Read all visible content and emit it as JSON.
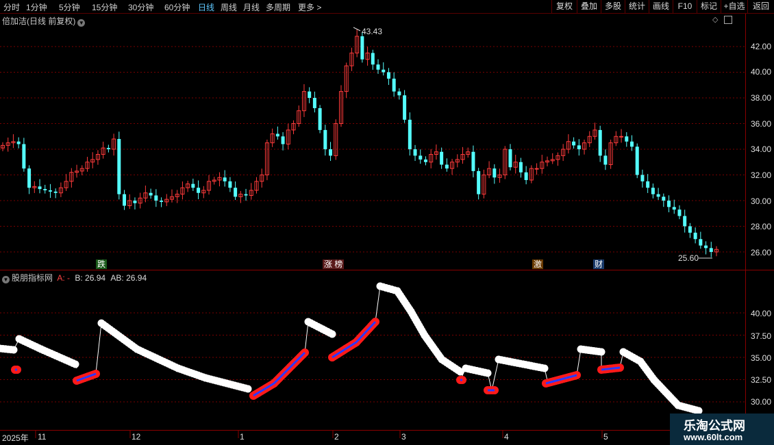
{
  "toolbar": {
    "periods": [
      "分时",
      "1分钟",
      "5分钟",
      "15分钟",
      "30分钟",
      "60分钟",
      "日线",
      "周线",
      "月线",
      "多周期",
      "更多 >"
    ],
    "active_period": "日线",
    "right_buttons": [
      "复权",
      "叠加",
      "多股",
      "统计",
      "画线",
      "F10",
      "标记",
      "+自选",
      "返回"
    ]
  },
  "main_pane": {
    "title": "倍加洁(日线 前复权)",
    "price_axis": [
      "42.00",
      "40.00",
      "38.00",
      "36.00",
      "34.00",
      "32.00",
      "30.00",
      "28.00",
      "26.00"
    ],
    "high_label": "43.43",
    "low_label": "25.60",
    "event_tags": [
      "跌",
      "涨 榜",
      "激",
      "财"
    ]
  },
  "indicator_pane": {
    "title": "股朋指标网",
    "a_label": "A: -",
    "b_label": "B: 26.94",
    "ab_label": "AB: 26.94",
    "axis": [
      "40.00",
      "37.50",
      "35.00",
      "32.50",
      "30.00"
    ]
  },
  "date_axis": {
    "year": "2025年",
    "months": [
      "11",
      "12",
      "1",
      "2",
      "3",
      "4",
      "5"
    ]
  },
  "watermark": {
    "line1": "乐淘公式网",
    "line2": "www.60lt.com"
  },
  "colors": {
    "up": "#ff3b3b",
    "down": "#54ffff",
    "grid": "#7a0000",
    "active": "#5fc8ff"
  },
  "chart_data": {
    "type": "candlestick",
    "price_range": [
      25.0,
      44.0
    ],
    "candles_approx_close": [
      34.3,
      34.5,
      34.6,
      34.4,
      32.5,
      31.0,
      31.1,
      30.9,
      30.8,
      30.7,
      30.6,
      31.0,
      31.5,
      32.2,
      32.3,
      32.5,
      33.0,
      33.2,
      33.6,
      34.1,
      34.0,
      34.8,
      30.5,
      29.6,
      30.0,
      29.8,
      30.2,
      30.6,
      30.4,
      30.0,
      29.9,
      30.1,
      30.3,
      30.5,
      31.0,
      31.3,
      31.0,
      30.6,
      30.8,
      31.5,
      31.6,
      31.8,
      31.5,
      31.0,
      30.3,
      30.5,
      30.4,
      30.8,
      31.5,
      32.0,
      34.5,
      35.2,
      35.0,
      34.4,
      35.5,
      36.0,
      37.0,
      38.5,
      38.0,
      37.2,
      35.5,
      34.0,
      33.5,
      36.0,
      38.5,
      40.5,
      41.5,
      42.8,
      41.0,
      41.5,
      40.6,
      40.2,
      40.0,
      39.5,
      38.5,
      38.2,
      36.3,
      34.0,
      33.5,
      33.2,
      33.0,
      33.6,
      33.8,
      32.8,
      32.5,
      33.0,
      33.2,
      33.6,
      33.8,
      32.3,
      30.5,
      32.0,
      32.5,
      31.8,
      32.0,
      34.0,
      32.6,
      33.0,
      32.2,
      31.6,
      32.5,
      32.5,
      33.0,
      33.1,
      33.2,
      33.5,
      34.0,
      34.6,
      34.3,
      34.0,
      34.5,
      35.0,
      35.5,
      33.5,
      32.8,
      34.5,
      35.0,
      35.0,
      34.6,
      34.2,
      32.0,
      31.5,
      31.0,
      30.5,
      30.3,
      30.0,
      29.5,
      29.3,
      28.8,
      28.0,
      27.5,
      27.0,
      26.5,
      26.3,
      26.0,
      26.2
    ],
    "indicator_series": {
      "name": "股朋指标网",
      "note_values_range": [
        28.0,
        43.0
      ],
      "last_value": 26.94
    }
  }
}
